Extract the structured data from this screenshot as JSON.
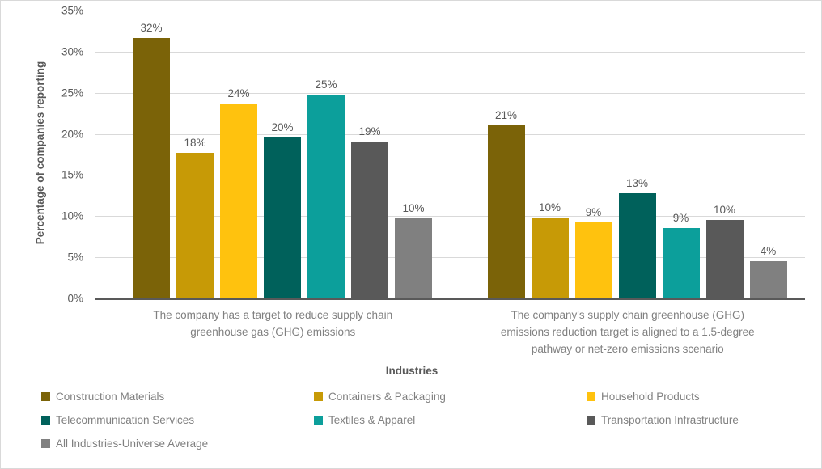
{
  "chart_data": {
    "type": "bar",
    "title": "",
    "xlabel": "Industries",
    "ylabel": "Percentage of companies reporting",
    "ylim": [
      0,
      35
    ],
    "ytick_labels": [
      "0%",
      "5%",
      "10%",
      "15%",
      "20%",
      "25%",
      "30%",
      "35%"
    ],
    "ytick_values": [
      0,
      5,
      10,
      15,
      20,
      25,
      30,
      35
    ],
    "grid": true,
    "legend_position": "bottom",
    "categories": [
      "The company has a target to reduce supply chain greenhouse gas (GHG) emissions",
      "The company's supply chain greenhouse (GHG) emissions reduction target is aligned to a 1.5-degree pathway or net-zero emissions scenario"
    ],
    "category_lines": [
      [
        "The company has a target to reduce supply chain",
        "greenhouse gas (GHG) emissions"
      ],
      [
        "The company's supply chain greenhouse (GHG)",
        "emissions reduction target is aligned to a 1.5-degree",
        "pathway or net-zero emissions scenario"
      ]
    ],
    "series": [
      {
        "name": "Construction Materials",
        "color": "#7B6308",
        "values": [
          31.7,
          21.0
        ],
        "labels": [
          "32%",
          "21%"
        ]
      },
      {
        "name": "Containers & Packaging",
        "color": "#C79A06",
        "values": [
          17.7,
          9.8
        ],
        "labels": [
          "18%",
          "10%"
        ]
      },
      {
        "name": "Household Products",
        "color": "#FFC20E",
        "values": [
          23.7,
          9.2
        ],
        "labels": [
          "24%",
          "9%"
        ]
      },
      {
        "name": "Telecommunication Services",
        "color": "#00615B",
        "values": [
          19.6,
          12.8
        ],
        "labels": [
          "20%",
          "13%"
        ]
      },
      {
        "name": "Textiles & Apparel",
        "color": "#0C9F9B",
        "values": [
          24.8,
          8.6
        ],
        "labels": [
          "25%",
          "9%"
        ]
      },
      {
        "name": "Transportation Infrastructure",
        "color": "#595959",
        "values": [
          19.1,
          9.5
        ],
        "labels": [
          "19%",
          "10%"
        ]
      },
      {
        "name": "All Industries-Universe Average",
        "color": "#808080",
        "values": [
          9.7,
          4.5
        ],
        "labels": [
          "10%",
          "4%"
        ]
      }
    ]
  }
}
